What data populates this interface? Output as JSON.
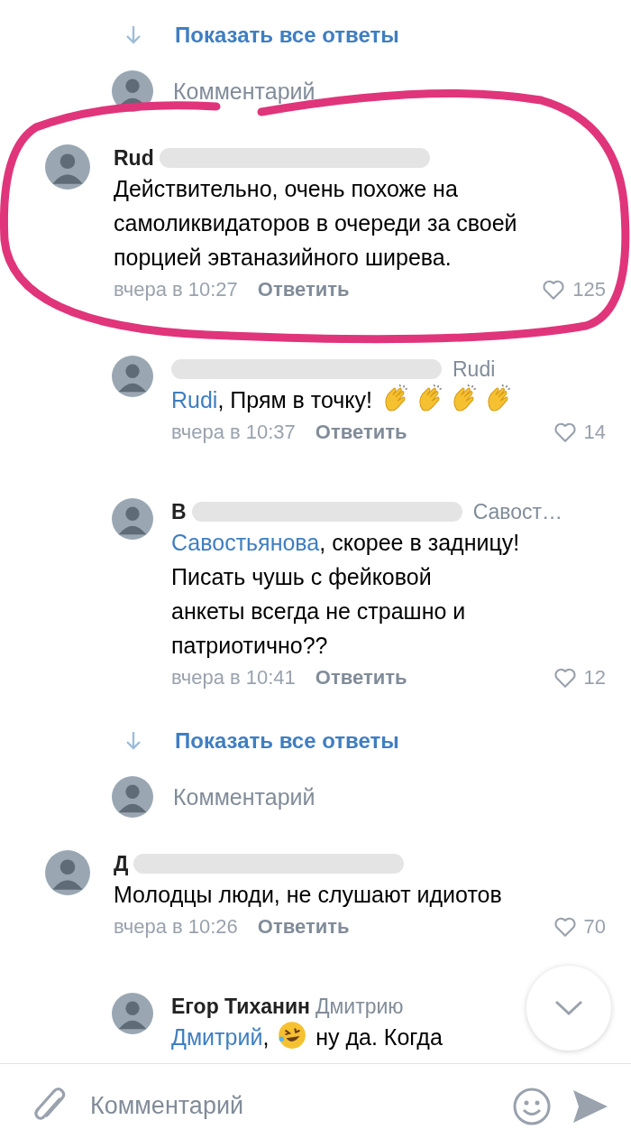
{
  "items": [
    {
      "kind": "show_replies",
      "label": "Показать все ответы"
    },
    {
      "kind": "prompt",
      "placeholder": "Комментарий"
    },
    {
      "kind": "comment",
      "author": "Rud",
      "redacted": true,
      "highlighted": true,
      "text": "Действительно, очень похоже на самоликвидаторов в очереди за своей порцией эвтаназийного ширева.",
      "time": "вчера в 10:27",
      "reply": "Ответить",
      "likes": "125",
      "children": [
        {
          "kind": "comment",
          "redacted": true,
          "reply_to": "Rudi",
          "mention": "Rudi",
          "text": ", Прям в точку!",
          "emojis": [
            {
              "kind": "clap"
            },
            {
              "kind": "clap"
            },
            {
              "kind": "clap"
            },
            {
              "kind": "clap"
            }
          ],
          "time": "вчера в 10:37",
          "reply": "Ответить",
          "likes": "14"
        },
        {
          "kind": "comment",
          "author": "В",
          "redacted": true,
          "reply_to": "Савост…",
          "mention": "Савостьянова",
          "text": ", скорее в задницу!\nПисать чушь с фейковой\nанкеты всегда не страшно и\nпатриотично??",
          "time": "вчера в 10:41",
          "reply": "Ответить",
          "likes": "12"
        }
      ]
    },
    {
      "kind": "show_replies",
      "label": "Показать все ответы"
    },
    {
      "kind": "prompt",
      "placeholder": "Комментарий"
    },
    {
      "kind": "comment",
      "author": "Д",
      "redacted": true,
      "text": "Молодцы люди, не слушают идиотов",
      "time": "вчера в 10:26",
      "reply": "Ответить",
      "likes": "70",
      "children": [
        {
          "kind": "comment",
          "author": "Егор Тиханин",
          "reply_to": "Дмитрию",
          "mention": "Дмитрий",
          "text": ",",
          "emojis": [
            {
              "kind": "laugh"
            }
          ],
          "text_after": "ну да. Когда"
        }
      ]
    }
  ],
  "composer": {
    "placeholder": "Комментарий"
  }
}
